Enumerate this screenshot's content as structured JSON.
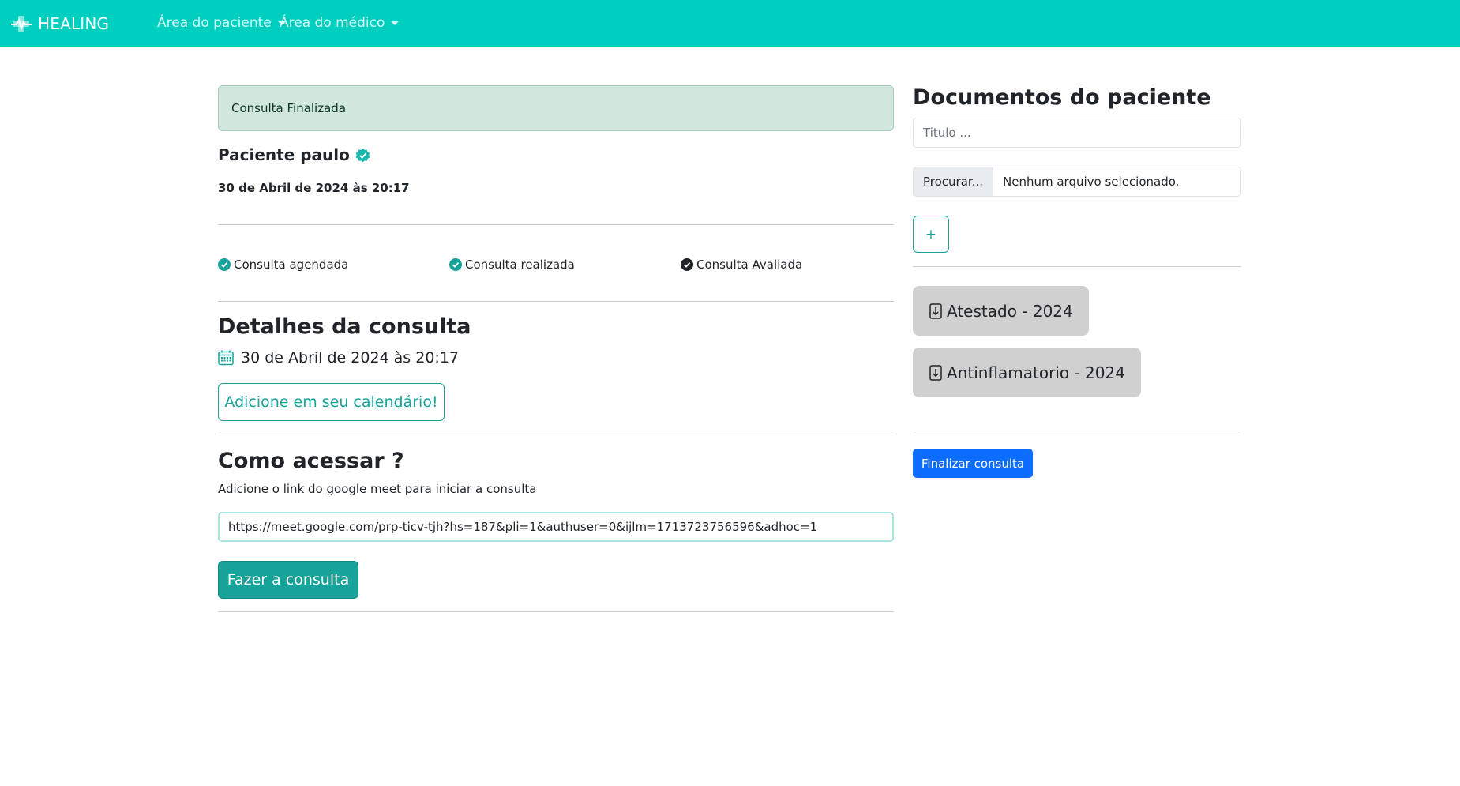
{
  "navbar": {
    "brand": "HEALING",
    "menus": [
      {
        "label": "Área do paciente"
      },
      {
        "label": "Área do médico"
      }
    ],
    "color": "#00cfc0"
  },
  "alert": {
    "text": "Consulta Finalizada"
  },
  "patient": {
    "name": "Paciente paulo",
    "datetime": "30 de Abril de 2024 às 20:17"
  },
  "steps": [
    {
      "label": "Consulta agendada",
      "state": "done",
      "icon": "check-circle-icon"
    },
    {
      "label": "Consulta realizada",
      "state": "done",
      "icon": "check-circle-icon"
    },
    {
      "label": "Consulta Avaliada",
      "state": "pending",
      "icon": "check-circle-icon"
    }
  ],
  "details": {
    "title": "Detalhes da consulta",
    "datetime": "30 de Abril de 2024 às 20:17",
    "calendar_button": "Adicione em seu calendário!"
  },
  "access": {
    "title": "Como acessar ?",
    "description": "Adicione o link do google meet para iniciar a consulta",
    "meet_url": "https://meet.google.com/prp-ticv-tjh?hs=187&pli=1&authuser=0&ijlm=1713723756596&adhoc=1",
    "start_button": "Fazer a consulta"
  },
  "documents": {
    "title": "Documentos do paciente",
    "title_placeholder": "Titulo ...",
    "file_button": "Procurar...",
    "file_label": "Nenhum arquivo selecionado.",
    "add_button": "+",
    "items": [
      {
        "label": "Atestado - 2024"
      },
      {
        "label": "Antinflamatorio - 2024"
      }
    ],
    "finish_button": "Finalizar consulta"
  },
  "colors": {
    "accent": "#17a39a",
    "alert_bg": "#d1e7dd",
    "primary_blue": "#0d6efd",
    "doc_bg": "#d0d0d0"
  }
}
